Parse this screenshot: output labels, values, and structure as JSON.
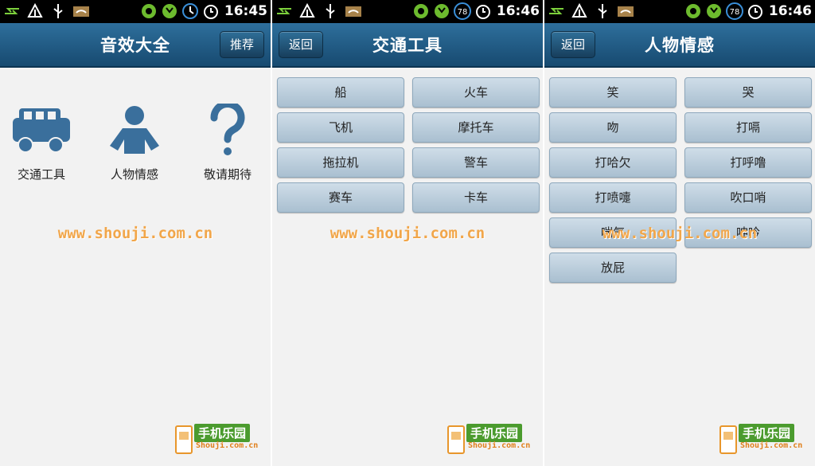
{
  "colors": {
    "titlebar": "#1f5a86",
    "button": "#b9ccdb",
    "watermark": "#f1a64a",
    "logo_green": "#4b9b2e"
  },
  "watermark": "www.shouji.com.cn",
  "logo": {
    "brand": "手机乐园",
    "domain": "Shouji.com.cn"
  },
  "screen1": {
    "status": {
      "time": "16:45",
      "icons": [
        "usb-transfer-icon",
        "upload-icon",
        "usb-icon",
        "wifi-icon",
        "sync-icon",
        "signal-icon",
        "clock-icon",
        "alarm-icon"
      ]
    },
    "title": "音效大全",
    "right_button": "推荐",
    "categories": [
      {
        "label": "交通工具",
        "icon": "car-icon"
      },
      {
        "label": "人物情感",
        "icon": "person-icon"
      },
      {
        "label": "敬请期待",
        "icon": "question-icon"
      }
    ]
  },
  "screen2": {
    "status": {
      "time": "16:46",
      "battery": "78"
    },
    "title": "交通工具",
    "back_button": "返回",
    "buttons": [
      "船",
      "火车",
      "飞机",
      "摩托车",
      "拖拉机",
      "警车",
      "赛车",
      "卡车"
    ]
  },
  "screen3": {
    "status": {
      "time": "16:46",
      "battery": "78"
    },
    "title": "人物情感",
    "back_button": "返回",
    "buttons": [
      "笑",
      "哭",
      "吻",
      "打嗝",
      "打哈欠",
      "打呼噜",
      "打喷嚏",
      "吹口哨",
      "喘气",
      "呻吟",
      "放屁"
    ]
  }
}
